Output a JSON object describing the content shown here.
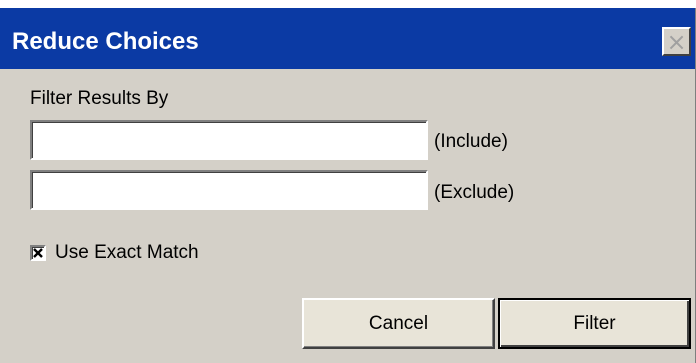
{
  "dialog": {
    "title": "Reduce Choices",
    "close_glyph": "×",
    "title_bar_color": "#0b3aa4",
    "background_color": "#d4d0c8"
  },
  "filter": {
    "group_label": "Filter Results By",
    "include_value": "",
    "include_label": "(Include)",
    "exclude_value": "",
    "exclude_label": "(Exclude)"
  },
  "options": {
    "exact_match_label": "Use Exact Match",
    "exact_match_checked": true
  },
  "buttons": {
    "cancel_label": "Cancel",
    "filter_label": "Filter"
  },
  "icons": {
    "close": "close-icon",
    "check": "checkmark-icon"
  }
}
